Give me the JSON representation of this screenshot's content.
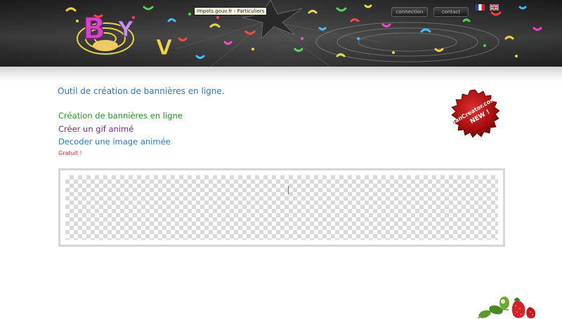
{
  "header": {
    "tooltip": "Impots.gouv.fr - Particuliers",
    "nav": {
      "connection_label": "connection",
      "contact_label": "contact"
    },
    "languages": [
      {
        "icon": "flag-fr-icon",
        "code": "fr"
      },
      {
        "icon": "flag-en-icon",
        "code": "en"
      }
    ]
  },
  "main": {
    "title": "Outil de création de bannières en ligne.",
    "links": {
      "create_banner": "Création de bannières en ligne",
      "create_gif": "Créer un gif animé",
      "decode_image": "Decoder une image animée"
    },
    "free_label": "Gratuit !"
  },
  "badge": {
    "text_line1": "BanCreator.com",
    "text_line2": "NEW !",
    "color": "#b81212"
  },
  "colors": {
    "title": "#2878c8",
    "link_green": "#1a9a1a",
    "link_purple": "#7a2a8a",
    "link_blue": "#2878c8",
    "free_red": "#e02020"
  }
}
